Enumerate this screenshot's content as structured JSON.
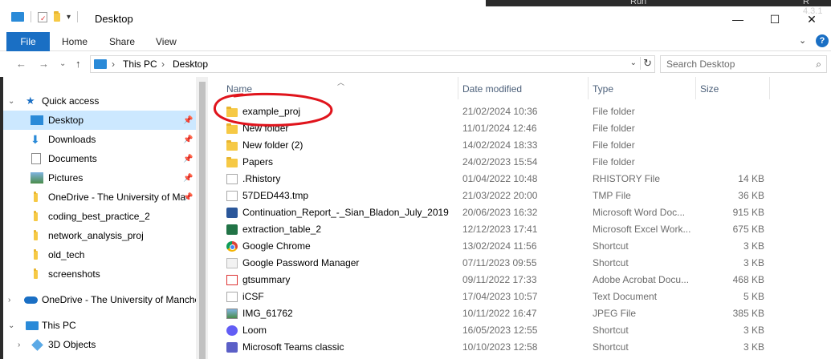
{
  "window": {
    "title": "Desktop",
    "minimize": "—",
    "maximize": "☐",
    "close": "✕"
  },
  "taskstrip": {
    "text1": "Run",
    "text2": "R 4.3.1"
  },
  "ribbon": {
    "tabs": [
      "File",
      "Home",
      "Share",
      "View"
    ],
    "collapse": "⌄",
    "help": "?"
  },
  "address": {
    "back": "←",
    "forward": "→",
    "recent": "⌄",
    "up": "↑",
    "crumbs": [
      "This PC",
      "Desktop"
    ],
    "separator": "›",
    "search_placeholder": "Search Desktop"
  },
  "nav": {
    "quick_access": "Quick access",
    "items": [
      {
        "label": "Desktop",
        "icon": "desktop-icon",
        "pinned": true
      },
      {
        "label": "Downloads",
        "icon": "downloads-icon",
        "pinned": true
      },
      {
        "label": "Documents",
        "icon": "documents-icon",
        "pinned": true
      },
      {
        "label": "Pictures",
        "icon": "pictures-icon",
        "pinned": true
      },
      {
        "label": "OneDrive - The University of Ma",
        "icon": "folder-icon",
        "pinned": true
      },
      {
        "label": "coding_best_practice_2",
        "icon": "folder-icon",
        "pinned": false
      },
      {
        "label": "network_analysis_proj",
        "icon": "folder-icon",
        "pinned": false
      },
      {
        "label": "old_tech",
        "icon": "folder-icon",
        "pinned": false
      },
      {
        "label": "screenshots",
        "icon": "folder-icon",
        "pinned": false
      }
    ],
    "onedrive": "OneDrive - The University of Manche",
    "this_pc": "This PC",
    "objects3d": "3D Objects"
  },
  "columns": {
    "name": "Name",
    "date": "Date modified",
    "type": "Type",
    "size": "Size"
  },
  "files": [
    {
      "name": "example_proj",
      "date": "21/02/2024 10:36",
      "type": "File folder",
      "size": "",
      "icon": "folder-icon"
    },
    {
      "name": "New folder",
      "date": "11/01/2024 12:46",
      "type": "File folder",
      "size": "",
      "icon": "folder-icon"
    },
    {
      "name": "New folder (2)",
      "date": "14/02/2024 18:33",
      "type": "File folder",
      "size": "",
      "icon": "folder-icon"
    },
    {
      "name": "Papers",
      "date": "24/02/2023 15:54",
      "type": "File folder",
      "size": "",
      "icon": "folder-icon"
    },
    {
      "name": ".Rhistory",
      "date": "01/04/2022 10:48",
      "type": "RHISTORY File",
      "size": "14 KB",
      "icon": "file-icon"
    },
    {
      "name": "57DED443.tmp",
      "date": "21/03/2022 20:00",
      "type": "TMP File",
      "size": "36 KB",
      "icon": "file-icon"
    },
    {
      "name": "Continuation_Report_-_Sian_Bladon_July_2019",
      "date": "20/06/2023 16:32",
      "type": "Microsoft Word Doc...",
      "size": "915 KB",
      "icon": "word-icon"
    },
    {
      "name": "extraction_table_2",
      "date": "12/12/2023 17:41",
      "type": "Microsoft Excel Work...",
      "size": "675 KB",
      "icon": "excel-icon"
    },
    {
      "name": "Google Chrome",
      "date": "13/02/2024 11:56",
      "type": "Shortcut",
      "size": "3 KB",
      "icon": "chrome-icon"
    },
    {
      "name": "Google Password Manager",
      "date": "07/11/2023 09:55",
      "type": "Shortcut",
      "size": "3 KB",
      "icon": "shortcut-icon"
    },
    {
      "name": "gtsummary",
      "date": "09/11/2022 17:33",
      "type": "Adobe Acrobat Docu...",
      "size": "468 KB",
      "icon": "pdf-icon"
    },
    {
      "name": "iCSF",
      "date": "17/04/2023 10:57",
      "type": "Text Document",
      "size": "5 KB",
      "icon": "file-icon"
    },
    {
      "name": "IMG_61762",
      "date": "10/11/2022 16:47",
      "type": "JPEG File",
      "size": "385 KB",
      "icon": "image-icon"
    },
    {
      "name": "Loom",
      "date": "16/05/2023 12:55",
      "type": "Shortcut",
      "size": "3 KB",
      "icon": "loom-icon"
    },
    {
      "name": "Microsoft Teams classic",
      "date": "10/10/2023 12:58",
      "type": "Shortcut",
      "size": "3 KB",
      "icon": "teams-icon"
    }
  ],
  "colors": {
    "accent": "#1a6fc4",
    "selection": "#cce8ff",
    "annotation": "#e0141c"
  }
}
